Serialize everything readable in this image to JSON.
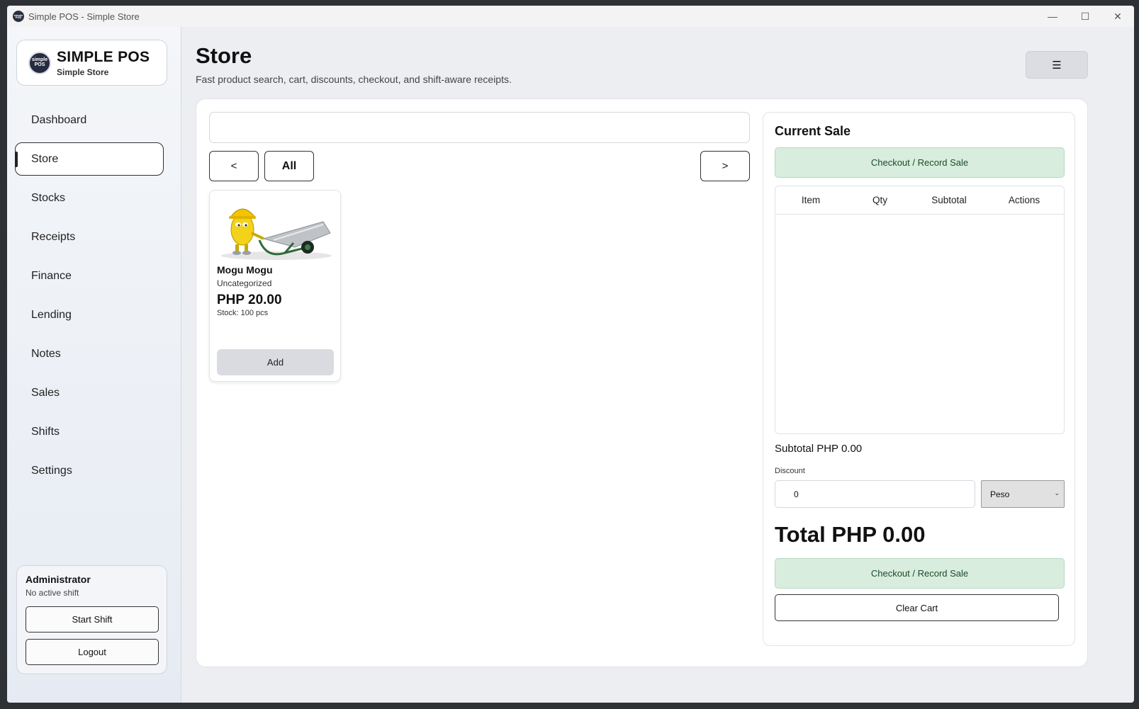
{
  "window": {
    "title": "Simple POS - Simple Store",
    "app_icon_text": "simple POS",
    "controls": {
      "minimize": "—",
      "maximize": "☐",
      "close": "✕"
    }
  },
  "sidebar": {
    "brand": {
      "title": "SIMPLE POS",
      "subtitle": "Simple Store",
      "logo_text": "simple POS"
    },
    "items": [
      {
        "label": "Dashboard"
      },
      {
        "label": "Store"
      },
      {
        "label": "Stocks"
      },
      {
        "label": "Receipts"
      },
      {
        "label": "Finance"
      },
      {
        "label": "Lending"
      },
      {
        "label": "Notes"
      },
      {
        "label": "Sales"
      },
      {
        "label": "Shifts"
      },
      {
        "label": "Settings"
      }
    ],
    "active": "Store",
    "user": {
      "name": "Administrator",
      "shift_status": "No active shift",
      "start_shift_label": "Start Shift",
      "logout_label": "Logout"
    }
  },
  "header": {
    "title": "Store",
    "subtitle": "Fast product search, cart, discounts, checkout, and shift-aware receipts.",
    "menu_icon": "☰"
  },
  "catalog": {
    "search": {
      "value": "",
      "placeholder": ""
    },
    "prev_label": "<",
    "category_label": "All",
    "next_label": ">",
    "products": [
      {
        "name": "Mogu Mogu",
        "category": "Uncategorized",
        "price": "PHP 20.00",
        "stock": "Stock: 100 pcs",
        "add_label": "Add"
      }
    ]
  },
  "sale": {
    "title": "Current Sale",
    "checkout_label": "Checkout / Record Sale",
    "columns": [
      "Item",
      "Qty",
      "Subtotal",
      "Actions"
    ],
    "subtotal": "Subtotal PHP 0.00",
    "discount_label": "Discount",
    "discount_value": "0",
    "discount_type": "Peso",
    "total": "Total PHP 0.00",
    "clear_label": "Clear Cart"
  }
}
